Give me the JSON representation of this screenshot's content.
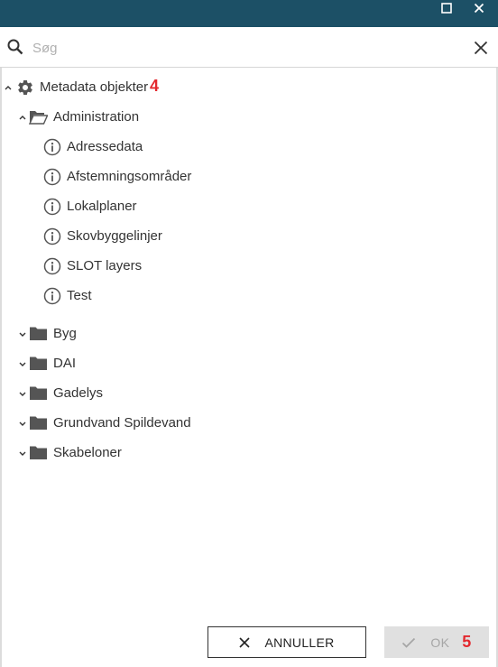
{
  "search": {
    "placeholder": "Søg"
  },
  "tree": {
    "root": {
      "label": "Metadata objekter",
      "badge": "4"
    },
    "administration": {
      "label": "Administration",
      "items": [
        "Adressedata",
        "Afstemningsområder",
        "Lokalplaner",
        "Skovbyggelinjer",
        "SLOT layers",
        "Test"
      ]
    },
    "folders": [
      "Byg",
      "DAI",
      "Gadelys",
      "Grundvand Spildevand",
      "Skabeloner"
    ]
  },
  "footer": {
    "cancel_label": "ANNULLER",
    "ok_label": "OK",
    "ok_badge": "5"
  },
  "colors": {
    "titlebar": "#1c5066",
    "badge": "#e3282e",
    "icon": "#555555",
    "ok_disabled_bg": "#e0e0e0"
  },
  "icons": {
    "window": [
      "maximize-icon",
      "close-icon"
    ],
    "search": "search-icon",
    "clear": "clear-icon",
    "root": "gear-icon",
    "open_folder": "folder-open-icon",
    "folder": "folder-icon",
    "leaf": "info-icon"
  }
}
